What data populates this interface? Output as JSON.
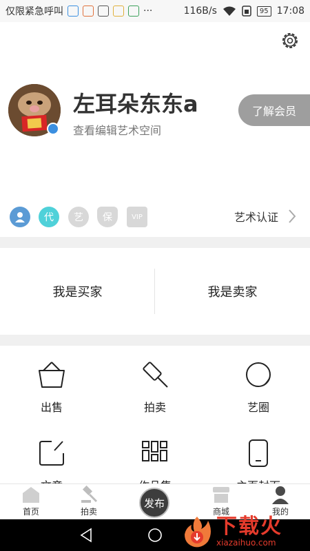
{
  "status_bar": {
    "notification": "仅限紧急呼叫",
    "speed": "116B/s",
    "battery": "95",
    "time": "17:08",
    "more": "···"
  },
  "profile": {
    "name": "左耳朵东东a",
    "subtitle": "查看编辑艺术空间",
    "member_button": "了解会员"
  },
  "certifications": {
    "badges": [
      "代",
      "艺",
      "保",
      "VIP"
    ],
    "link_label": "艺术认证",
    "colors": {
      "user": "#5b9bd5",
      "agent": "#4fd1d9",
      "inactive": "#d8d8d8"
    }
  },
  "roles": {
    "buyer": "我是买家",
    "seller": "我是卖家"
  },
  "grid": {
    "items": [
      "出售",
      "拍卖",
      "艺圈",
      "文章",
      "作品集",
      "主页封面"
    ]
  },
  "tab_bar": {
    "items": [
      "首页",
      "拍卖",
      "商城",
      "我的"
    ],
    "publish": "发布"
  },
  "watermark": {
    "main": "下载火",
    "sub": "xiazaihuo.com"
  }
}
